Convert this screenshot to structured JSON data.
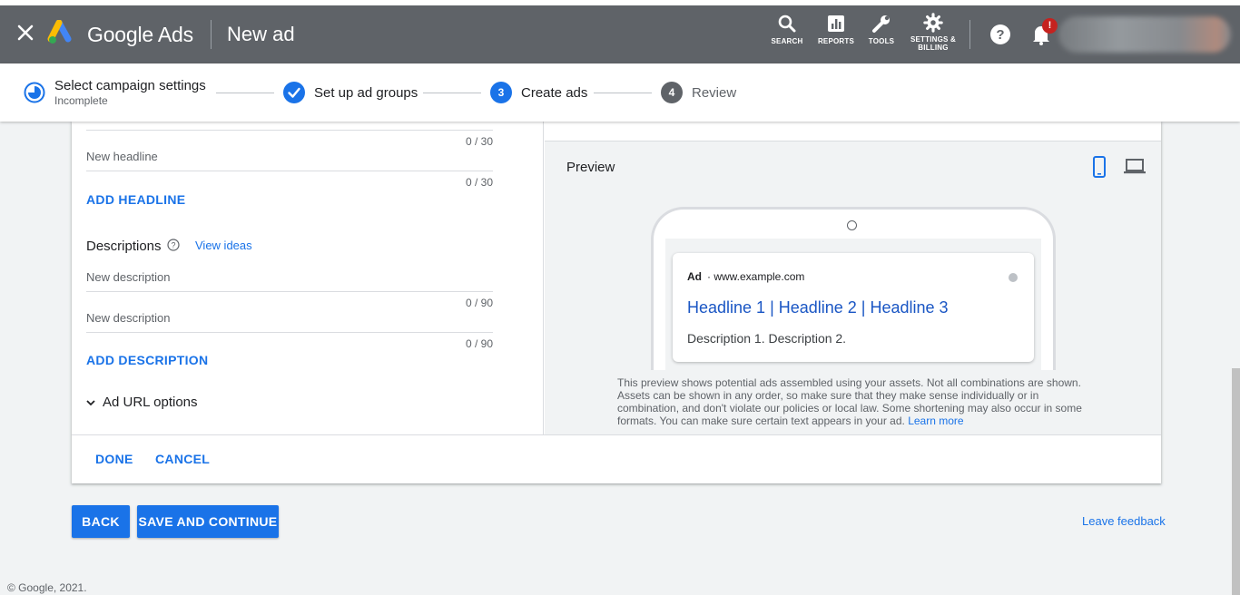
{
  "header": {
    "brand": "Google Ads",
    "title": "New ad",
    "tools": [
      {
        "label": "SEARCH",
        "icon": "search-icon"
      },
      {
        "label": "REPORTS",
        "icon": "reports-icon"
      },
      {
        "label": "TOOLS",
        "icon": "wrench-icon"
      },
      {
        "label_line1": "SETTINGS &",
        "label_line2": "BILLING",
        "icon": "gear-icon"
      }
    ],
    "notification_badge": "!"
  },
  "stepper": {
    "steps": [
      {
        "label": "Select campaign settings",
        "sublabel": "Incomplete",
        "state": "incomplete"
      },
      {
        "label": "Set up ad groups",
        "state": "done"
      },
      {
        "number": "3",
        "label": "Create ads",
        "state": "current"
      },
      {
        "number": "4",
        "label": "Review",
        "state": "pending"
      }
    ]
  },
  "form": {
    "headline_counter_1": "0 / 30",
    "headline_placeholder": "New headline",
    "headline_counter_2": "0 / 30",
    "add_headline": "ADD HEADLINE",
    "descriptions_label": "Descriptions",
    "view_ideas": "View ideas",
    "description_placeholder_1": "New description",
    "description_counter_1": "0 / 90",
    "description_placeholder_2": "New description",
    "description_counter_2": "0 / 90",
    "add_description": "ADD DESCRIPTION",
    "url_options": "Ad URL options"
  },
  "preview": {
    "title": "Preview",
    "ad_label": "Ad",
    "ad_url": "· www.example.com",
    "ad_headline": "Headline 1 | Headline 2 | Headline 3",
    "ad_description": "Description 1. Description 2.",
    "note": "This preview shows potential ads assembled using your assets. Not all combinations are shown. Assets can be shown in any order, so make sure that they make sense individually or in combination, and don't violate our policies or local law. Some shortening may also occur in some formats. You can make sure certain text appears in your ad.",
    "learn_more": "Learn more"
  },
  "actions": {
    "done": "DONE",
    "cancel": "CANCEL",
    "back": "BACK",
    "save_continue": "SAVE AND CONTINUE",
    "leave_feedback": "Leave feedback"
  },
  "footer": {
    "copyright": "© Google, 2021."
  },
  "colors": {
    "topbar": "#5f6368",
    "accent": "#1a73e8",
    "headline_link": "#1a56c4",
    "badge": "#c5221f"
  }
}
